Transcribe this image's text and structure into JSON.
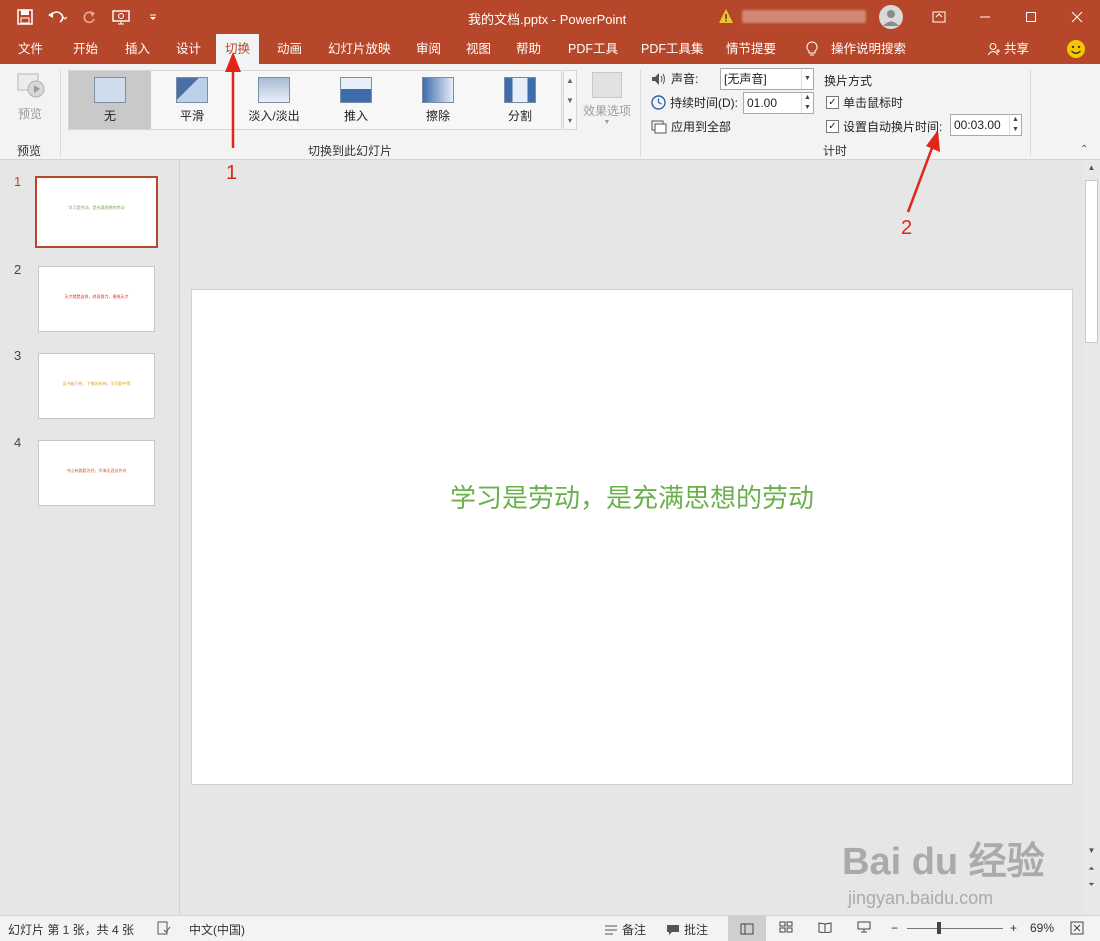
{
  "window": {
    "doc_title": "我的文档.pptx  -  PowerPoint"
  },
  "tabs": [
    "文件",
    "开始",
    "插入",
    "设计",
    "切换",
    "动画",
    "幻灯片放映",
    "审阅",
    "视图",
    "帮助",
    "PDF工具",
    "PDF工具集",
    "情节提要",
    "操作说明搜索",
    "共享"
  ],
  "ribbon": {
    "preview_label": "预览",
    "preview_group": "预览",
    "transitions": [
      "无",
      "平滑",
      "淡入/淡出",
      "推入",
      "擦除",
      "分割"
    ],
    "effect_options": "效果选项",
    "transitions_group": "切换到此幻灯片",
    "sound_label": "声音:",
    "sound_value": "[无声音]",
    "duration_label": "持续时间(D):",
    "duration_value": "01.00",
    "apply_all": "应用到全部",
    "advance_label": "换片方式",
    "on_click": "单击鼠标时",
    "after_label": "设置自动换片时间:",
    "after_value": "00:03.00",
    "timing_group": "计时"
  },
  "annotations": [
    "1",
    "2"
  ],
  "slides": [
    {
      "num": "1",
      "text": "学习是劳动，是充满思想的劳动",
      "color": "#6ab04c"
    },
    {
      "num": "2",
      "text": "天才就是这样，终身努力，便成天才",
      "color": "#d62728"
    },
    {
      "num": "3",
      "text": "读书破万卷，下笔如有神，学问勤中得",
      "color": "#e6a700"
    },
    {
      "num": "4",
      "text": "书山有路勤为径，学海无涯苦作舟",
      "color": "#d65a1f"
    }
  ],
  "canvas": {
    "main_text": "学习是劳动，是充满思想的劳动"
  },
  "watermark": {
    "line1": "Bai du 经验",
    "line2": "jingyan.baidu.com"
  },
  "status": {
    "slide_info": "幻灯片 第 1 张，共 4 张",
    "language": "中文(中国)",
    "notes": "备注",
    "comments": "批注",
    "zoom": "69%"
  },
  "colors": {
    "accent": "#b7472a",
    "slide_text": "#6ab04c",
    "annotation": "#e0251b"
  }
}
